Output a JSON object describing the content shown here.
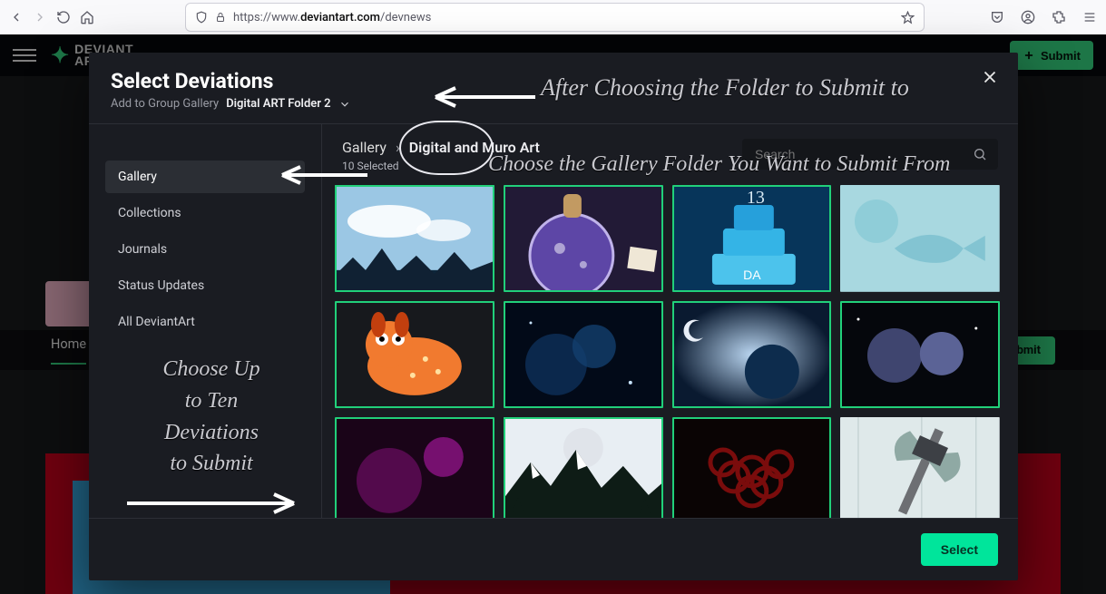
{
  "browser": {
    "url_prefix": "https://www.",
    "url_domain": "deviantart.com",
    "url_path": "/devnews"
  },
  "topbar": {
    "brand_line1": "DEVIANT",
    "brand_line2": "ART",
    "submit": "Submit"
  },
  "subnav": {
    "home": "Home",
    "submit": "Submit"
  },
  "modal": {
    "title": "Select Deviations",
    "dest_label": "Add to Group Gallery",
    "dest_folder": "Digital ART Folder 2",
    "sidebar": {
      "gallery": "Gallery",
      "collections": "Collections",
      "journals": "Journals",
      "status": "Status Updates",
      "all": "All DeviantArt"
    },
    "breadcrumb": {
      "root": "Gallery",
      "leaf": "Digital and Muro Art"
    },
    "selected_count": "10 Selected",
    "search_placeholder": "Search",
    "select_button": "Select",
    "thumbs": [
      {
        "selected": true,
        "key": "sky"
      },
      {
        "selected": true,
        "key": "potion"
      },
      {
        "selected": true,
        "key": "cake"
      },
      {
        "selected": false,
        "key": "fish"
      },
      {
        "selected": true,
        "key": "dog"
      },
      {
        "selected": true,
        "key": "nebula1"
      },
      {
        "selected": true,
        "key": "nebula2"
      },
      {
        "selected": true,
        "key": "moons"
      },
      {
        "selected": true,
        "key": "magenta"
      },
      {
        "selected": true,
        "key": "mountain"
      },
      {
        "selected": true,
        "key": "rose"
      },
      {
        "selected": false,
        "key": "hammer"
      }
    ]
  },
  "annotations": {
    "after": "After Choosing the Folder to Submit to",
    "choose_from": "Choose the Gallery Folder You Want to Submit From",
    "choose_ten_1": "Choose Up",
    "choose_ten_2": "to Ten",
    "choose_ten_3": "Deviations",
    "choose_ten_4": "to Submit"
  }
}
